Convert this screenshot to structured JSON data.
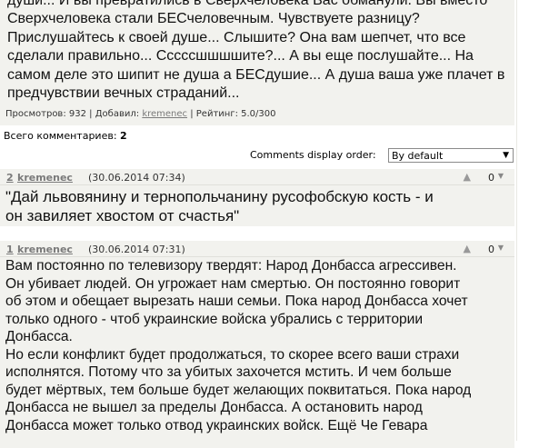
{
  "article": {
    "lines": [
      "души... И вы превратились в Сверхчеловека  Вас обманули. Вы вместо",
      "Сверхчеловека стали БЕСчеловечным. Чувствуете разницу?",
      "Прислушайтесь к своей душе... Слышите? Она вам шепчет, что все",
      "сделали правильно... Сссссшшшшите?... А вы еще послушайте... На",
      "самом деле это шипит не душа а БЕСдушие... А душа ваша уже плачет в",
      "предчувствии вечных страданий..."
    ]
  },
  "stats": {
    "views_label": "Просмотров:",
    "views": "932",
    "added_label": "Добавил:",
    "author": "kremenec",
    "rating_label": "Рейтинг:",
    "rating": "5.0/300"
  },
  "comments_total": {
    "label": "Всего комментариев:",
    "count": "2"
  },
  "order": {
    "label": "Comments display order:",
    "selected": "By default"
  },
  "comments": [
    {
      "num": "2",
      "user": "kremenec",
      "date": "(30.06.2014 07:34)",
      "vote_icon": "▲",
      "score": "0",
      "lines": [
        "\"Дай львовянину и тернопольчанину русофобскую кость - и",
        "он завиляет хвостом от счастья\""
      ]
    },
    {
      "num": "1",
      "user": "kremenec",
      "date": "(30.06.2014 07:31)",
      "vote_icon": "▲",
      "score": "0",
      "lines": [
        "Вам постоянно по телевизору твердят: Народ Донбасса агрессивен.",
        "Он убивает людей. Он угрожает нам смертью. Он постоянно говорит",
        "об этом и обещает вырезать наши семьи. Пока народ Донбасса хочет",
        "только одного - чтоб украинские войска убрались с территории",
        "Донбасса.",
        "Но если конфликт будет продолжаться, то скорее всего ваши страхи",
        "исполнятся. Потому что за убитых захочется мстить. И чем больше",
        "будет мёртвых, тем больше будет желающих поквитаться. Пока народ",
        "Донбасса не вышел за пределы Донбасса. А остановить народ",
        "Донбасса может только отвод украинских войск. Ещё Че Гевара"
      ]
    }
  ]
}
